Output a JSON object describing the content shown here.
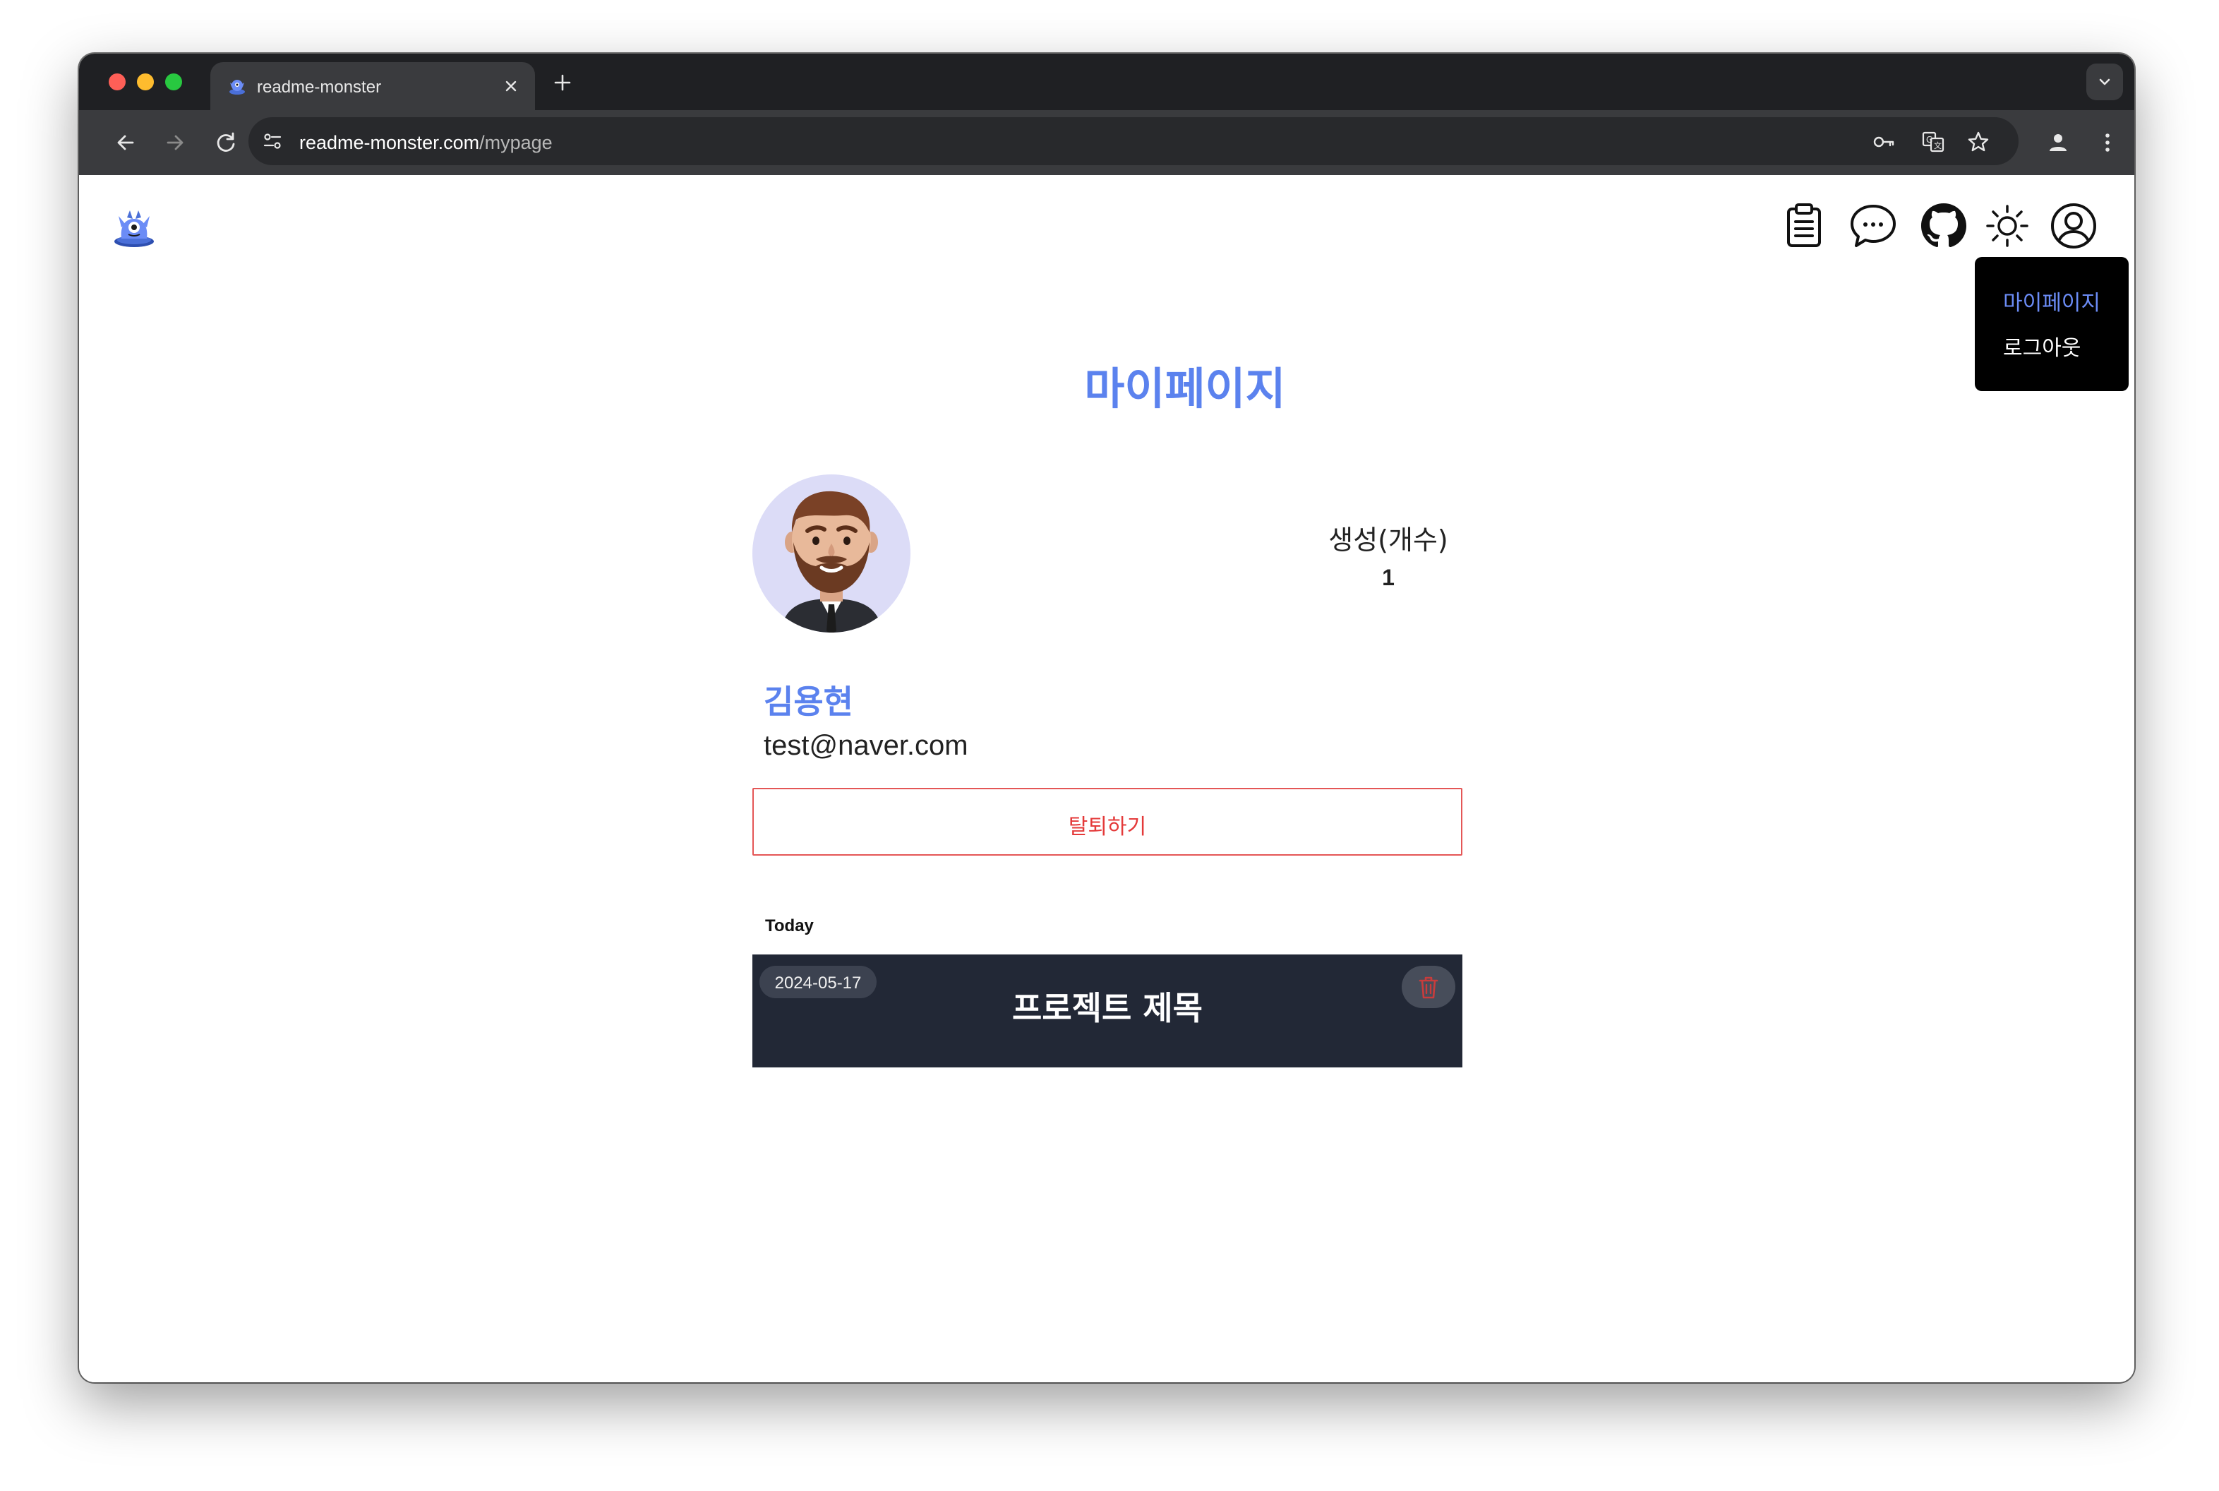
{
  "browser": {
    "tab_title": "readme-monster",
    "url_host": "readme-monster.com",
    "url_path": "/mypage"
  },
  "nav": {
    "icons": [
      "clipboard-icon",
      "chat-bubble-icon",
      "github-icon",
      "sun-icon",
      "user-circle-icon"
    ],
    "dropdown": {
      "mypage_label": "마이페이지",
      "logout_label": "로그아웃",
      "active_color": "#6b8cf6"
    }
  },
  "profile": {
    "page_title": "마이페이지",
    "stat_label": "생성(개수)",
    "stat_value": "1",
    "name": "김용현",
    "email": "test@naver.com",
    "withdraw_label": "탈퇴하기"
  },
  "projects": {
    "section_label": "Today",
    "items": [
      {
        "date": "2024-05-17",
        "title": "프로젝트 제목"
      }
    ]
  },
  "colors": {
    "accent": "#5b82ee",
    "danger": "#e43a3a",
    "card_bg": "#222836"
  }
}
